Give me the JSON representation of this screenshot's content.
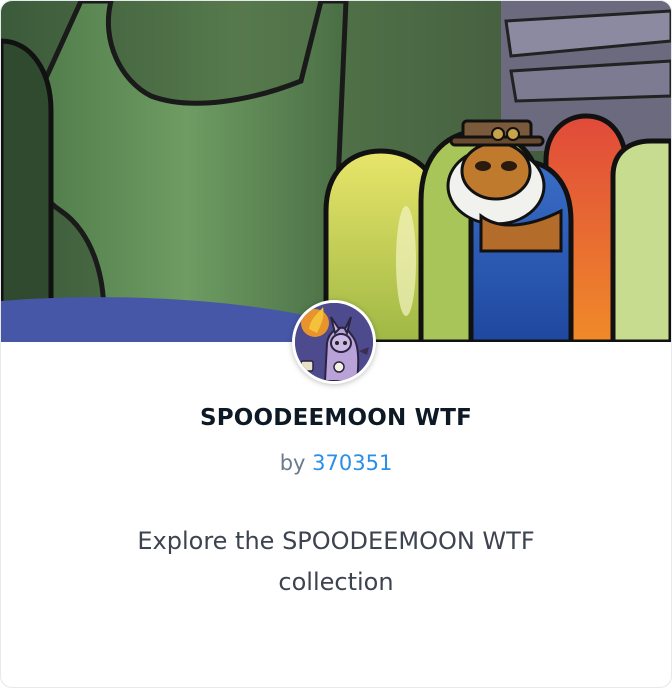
{
  "collection": {
    "title": "SPOODEEMOON WTF",
    "by_prefix": "by",
    "creator": "370351",
    "description": "Explore the SPOODEEMOON WTF collection"
  },
  "colors": {
    "title": "#0d1a26",
    "creator_link": "#2b8ee8",
    "byline": "#6b7a8c",
    "description": "#3d4450"
  }
}
